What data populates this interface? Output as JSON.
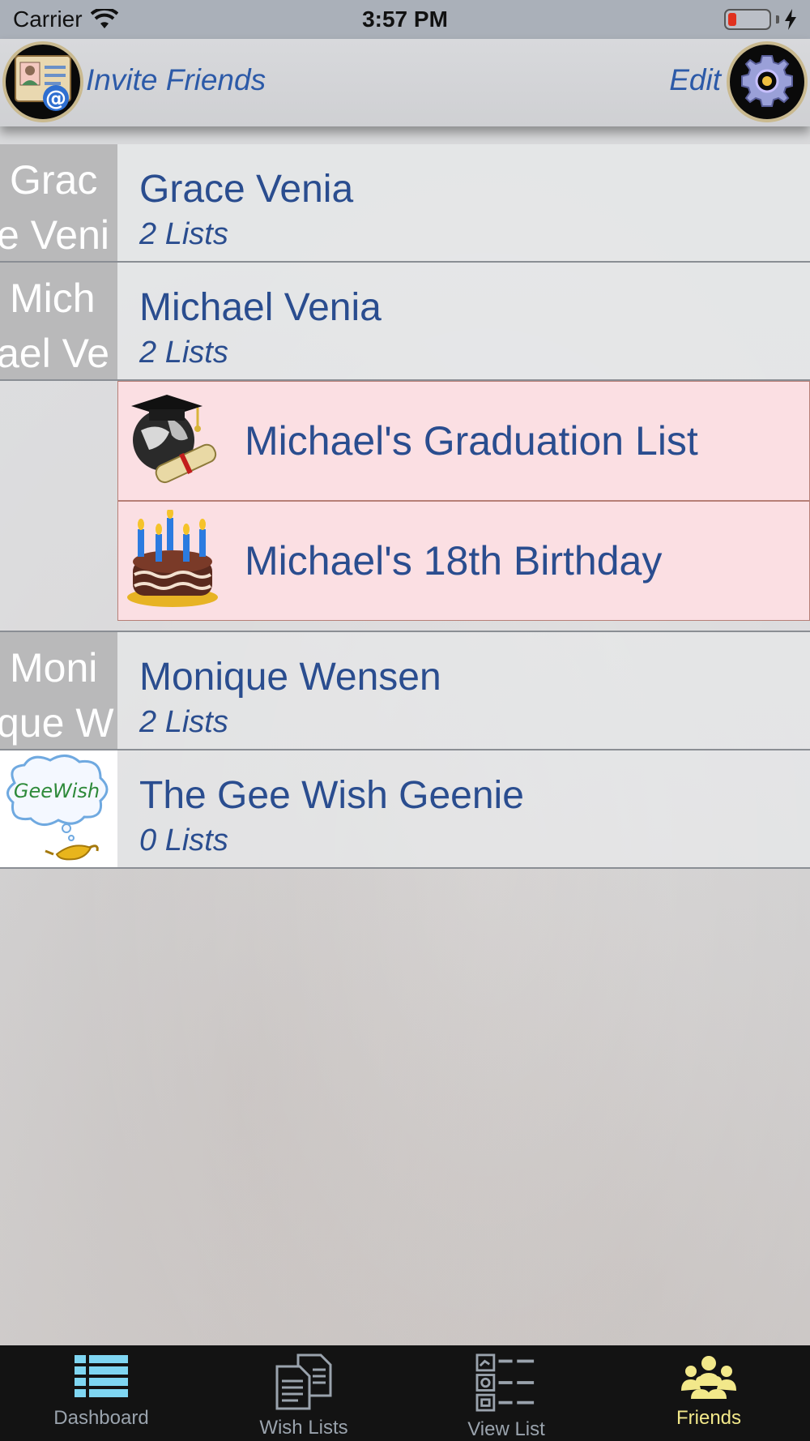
{
  "status_bar": {
    "carrier": "Carrier",
    "time": "3:57 PM"
  },
  "header": {
    "invite_label": "Invite Friends",
    "edit_label": "Edit"
  },
  "friends": [
    {
      "avatar_line1": "Grac",
      "avatar_line2": "e Veni",
      "name": "Grace Venia",
      "count": "2 Lists"
    },
    {
      "avatar_line1": "Mich",
      "avatar_line2": "ael Ve",
      "name": "Michael Venia",
      "count": "2 Lists"
    },
    {
      "avatar_line1": "Moni",
      "avatar_line2": "que W",
      "name": "Monique Wensen",
      "count": "2 Lists"
    },
    {
      "name": "The Gee Wish Geenie",
      "count": "0 Lists",
      "logo_text": "GeeWish"
    }
  ],
  "michael_lists": [
    {
      "label": "Michael's Graduation List",
      "icon": "graduation-cap-icon"
    },
    {
      "label": "Michael's 18th Birthday",
      "icon": "birthday-cake-icon"
    }
  ],
  "tab_bar": {
    "tabs": [
      {
        "label": "Dashboard",
        "icon": "dashboard-list-icon"
      },
      {
        "label": "Wish Lists",
        "icon": "documents-icon"
      },
      {
        "label": "View List",
        "icon": "view-list-icon"
      },
      {
        "label": "Friends",
        "icon": "friends-group-icon"
      }
    ],
    "active_tab": "Friends"
  },
  "colors": {
    "accent_text": "#2a4d8f",
    "active_tab": "#f2e88a",
    "sublist_background": "#fbdfe3"
  }
}
